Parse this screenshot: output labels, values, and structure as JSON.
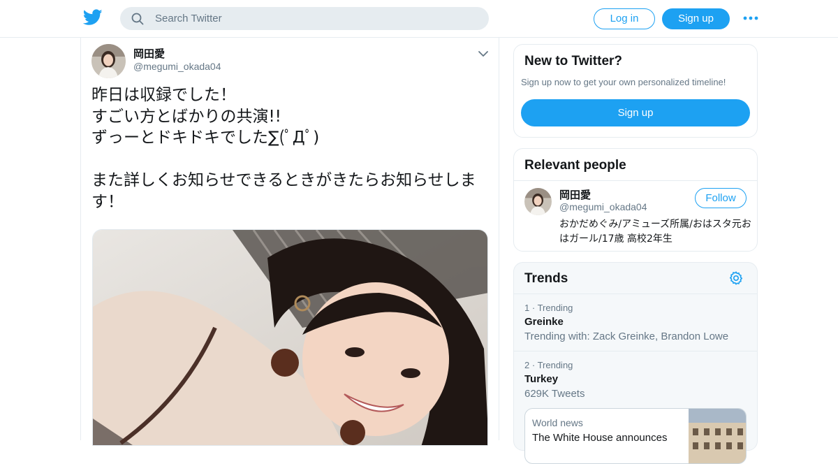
{
  "header": {
    "logo_icon": "twitter-bird-icon",
    "search_placeholder": "Search Twitter",
    "search_icon": "search-icon",
    "login_label": "Log in",
    "signup_label": "Sign up",
    "more_icon": "more-dots-icon",
    "accent": "#1da1f2"
  },
  "tweet": {
    "author_name": "岡田愛",
    "author_handle": "@megumi_okada04",
    "caret_icon": "chevron-down-icon",
    "text": "昨日は収録でした！\nすごい方とばかりの共演!!\nずっーとドキドキでした∑(ﾟДﾟ)\n\nまた詳しくお知らせできるときがきたらお知らせします！",
    "photo_alt": "selfie-photo"
  },
  "sidebar": {
    "new_to": {
      "title": "New to Twitter?",
      "subtitle": "Sign up now to get your own personalized timeline!",
      "signup_label": "Sign up"
    },
    "relevant": {
      "title": "Relevant people",
      "person": {
        "name": "岡田愛",
        "handle": "@megumi_okada04",
        "follow_label": "Follow",
        "bio": "おかだめぐみ/アミューズ所属/おはスタ元おはガール/17歳 高校2年生"
      }
    },
    "trends": {
      "title": "Trends",
      "settings_icon": "gear-icon",
      "items": [
        {
          "rank": "1",
          "meta": "Trending",
          "name": "Greinke",
          "sub": "Trending with: Zack Greinke, Brandon Lowe"
        },
        {
          "rank": "2",
          "meta": "Trending",
          "name": "Turkey",
          "sub": "629K Tweets"
        }
      ],
      "news": {
        "kicker": "World news",
        "headline": "The White House announces"
      }
    }
  }
}
